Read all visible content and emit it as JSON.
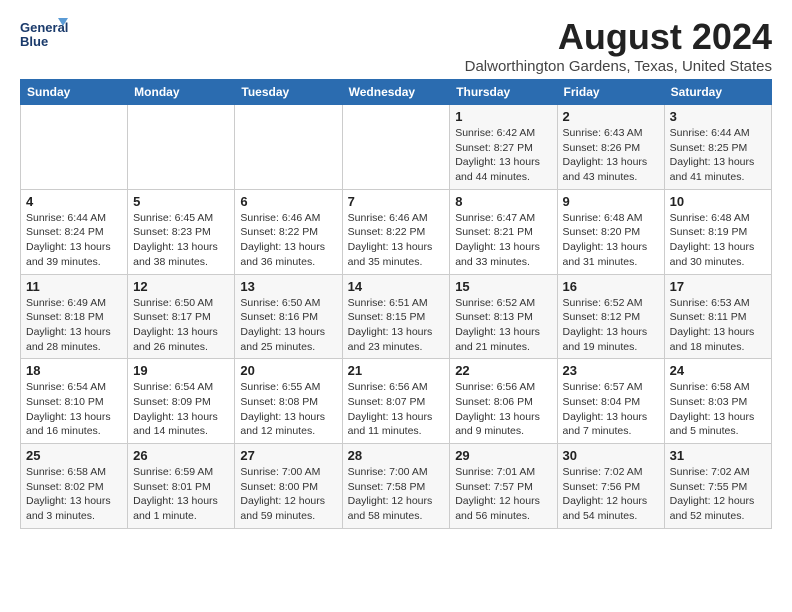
{
  "logo": {
    "line1": "General",
    "line2": "Blue"
  },
  "title": "August 2024",
  "subtitle": "Dalworthington Gardens, Texas, United States",
  "days_of_week": [
    "Sunday",
    "Monday",
    "Tuesday",
    "Wednesday",
    "Thursday",
    "Friday",
    "Saturday"
  ],
  "weeks": [
    [
      {
        "day": "",
        "info": ""
      },
      {
        "day": "",
        "info": ""
      },
      {
        "day": "",
        "info": ""
      },
      {
        "day": "",
        "info": ""
      },
      {
        "day": "1",
        "info": "Sunrise: 6:42 AM\nSunset: 8:27 PM\nDaylight: 13 hours\nand 44 minutes."
      },
      {
        "day": "2",
        "info": "Sunrise: 6:43 AM\nSunset: 8:26 PM\nDaylight: 13 hours\nand 43 minutes."
      },
      {
        "day": "3",
        "info": "Sunrise: 6:44 AM\nSunset: 8:25 PM\nDaylight: 13 hours\nand 41 minutes."
      }
    ],
    [
      {
        "day": "4",
        "info": "Sunrise: 6:44 AM\nSunset: 8:24 PM\nDaylight: 13 hours\nand 39 minutes."
      },
      {
        "day": "5",
        "info": "Sunrise: 6:45 AM\nSunset: 8:23 PM\nDaylight: 13 hours\nand 38 minutes."
      },
      {
        "day": "6",
        "info": "Sunrise: 6:46 AM\nSunset: 8:22 PM\nDaylight: 13 hours\nand 36 minutes."
      },
      {
        "day": "7",
        "info": "Sunrise: 6:46 AM\nSunset: 8:22 PM\nDaylight: 13 hours\nand 35 minutes."
      },
      {
        "day": "8",
        "info": "Sunrise: 6:47 AM\nSunset: 8:21 PM\nDaylight: 13 hours\nand 33 minutes."
      },
      {
        "day": "9",
        "info": "Sunrise: 6:48 AM\nSunset: 8:20 PM\nDaylight: 13 hours\nand 31 minutes."
      },
      {
        "day": "10",
        "info": "Sunrise: 6:48 AM\nSunset: 8:19 PM\nDaylight: 13 hours\nand 30 minutes."
      }
    ],
    [
      {
        "day": "11",
        "info": "Sunrise: 6:49 AM\nSunset: 8:18 PM\nDaylight: 13 hours\nand 28 minutes."
      },
      {
        "day": "12",
        "info": "Sunrise: 6:50 AM\nSunset: 8:17 PM\nDaylight: 13 hours\nand 26 minutes."
      },
      {
        "day": "13",
        "info": "Sunrise: 6:50 AM\nSunset: 8:16 PM\nDaylight: 13 hours\nand 25 minutes."
      },
      {
        "day": "14",
        "info": "Sunrise: 6:51 AM\nSunset: 8:15 PM\nDaylight: 13 hours\nand 23 minutes."
      },
      {
        "day": "15",
        "info": "Sunrise: 6:52 AM\nSunset: 8:13 PM\nDaylight: 13 hours\nand 21 minutes."
      },
      {
        "day": "16",
        "info": "Sunrise: 6:52 AM\nSunset: 8:12 PM\nDaylight: 13 hours\nand 19 minutes."
      },
      {
        "day": "17",
        "info": "Sunrise: 6:53 AM\nSunset: 8:11 PM\nDaylight: 13 hours\nand 18 minutes."
      }
    ],
    [
      {
        "day": "18",
        "info": "Sunrise: 6:54 AM\nSunset: 8:10 PM\nDaylight: 13 hours\nand 16 minutes."
      },
      {
        "day": "19",
        "info": "Sunrise: 6:54 AM\nSunset: 8:09 PM\nDaylight: 13 hours\nand 14 minutes."
      },
      {
        "day": "20",
        "info": "Sunrise: 6:55 AM\nSunset: 8:08 PM\nDaylight: 13 hours\nand 12 minutes."
      },
      {
        "day": "21",
        "info": "Sunrise: 6:56 AM\nSunset: 8:07 PM\nDaylight: 13 hours\nand 11 minutes."
      },
      {
        "day": "22",
        "info": "Sunrise: 6:56 AM\nSunset: 8:06 PM\nDaylight: 13 hours\nand 9 minutes."
      },
      {
        "day": "23",
        "info": "Sunrise: 6:57 AM\nSunset: 8:04 PM\nDaylight: 13 hours\nand 7 minutes."
      },
      {
        "day": "24",
        "info": "Sunrise: 6:58 AM\nSunset: 8:03 PM\nDaylight: 13 hours\nand 5 minutes."
      }
    ],
    [
      {
        "day": "25",
        "info": "Sunrise: 6:58 AM\nSunset: 8:02 PM\nDaylight: 13 hours\nand 3 minutes."
      },
      {
        "day": "26",
        "info": "Sunrise: 6:59 AM\nSunset: 8:01 PM\nDaylight: 13 hours\nand 1 minute."
      },
      {
        "day": "27",
        "info": "Sunrise: 7:00 AM\nSunset: 8:00 PM\nDaylight: 12 hours\nand 59 minutes."
      },
      {
        "day": "28",
        "info": "Sunrise: 7:00 AM\nSunset: 7:58 PM\nDaylight: 12 hours\nand 58 minutes."
      },
      {
        "day": "29",
        "info": "Sunrise: 7:01 AM\nSunset: 7:57 PM\nDaylight: 12 hours\nand 56 minutes."
      },
      {
        "day": "30",
        "info": "Sunrise: 7:02 AM\nSunset: 7:56 PM\nDaylight: 12 hours\nand 54 minutes."
      },
      {
        "day": "31",
        "info": "Sunrise: 7:02 AM\nSunset: 7:55 PM\nDaylight: 12 hours\nand 52 minutes."
      }
    ]
  ]
}
